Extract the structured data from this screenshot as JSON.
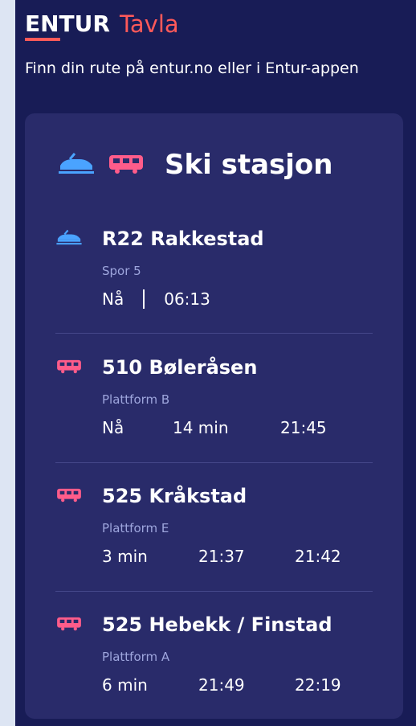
{
  "brand": {
    "logo_text": "ENTUR",
    "subtitle": "Tavla",
    "accent": "#ff5959"
  },
  "tagline": "Finn din rute på entur.no eller i Entur-appen",
  "station": {
    "name": "Ski stasjon",
    "icons": [
      "train-icon",
      "bus-icon"
    ],
    "departures": [
      {
        "mode": "train",
        "icon": "train-icon",
        "line": "R22 Rakkestad",
        "platform": "Spor 5",
        "times": [
          "Nå",
          "06:13"
        ],
        "separator": true
      },
      {
        "mode": "bus",
        "icon": "bus-icon",
        "line": "510 Bøleråsen",
        "platform": "Plattform B",
        "times": [
          "Nå",
          "14 min",
          "21:45"
        ]
      },
      {
        "mode": "bus",
        "icon": "bus-icon",
        "line": "525 Kråkstad",
        "platform": "Plattform E",
        "times": [
          "3 min",
          "21:37",
          "21:42"
        ]
      },
      {
        "mode": "bus",
        "icon": "bus-icon",
        "line": "525 Hebekk / Finstad",
        "platform": "Plattform A",
        "times": [
          "6 min",
          "21:49",
          "22:19"
        ]
      }
    ]
  },
  "colors": {
    "background": "#181c56",
    "card": "#292b6a",
    "train": "#4aa3ff",
    "bus": "#ff5c8a",
    "muted_text": "#9ea6dd"
  }
}
